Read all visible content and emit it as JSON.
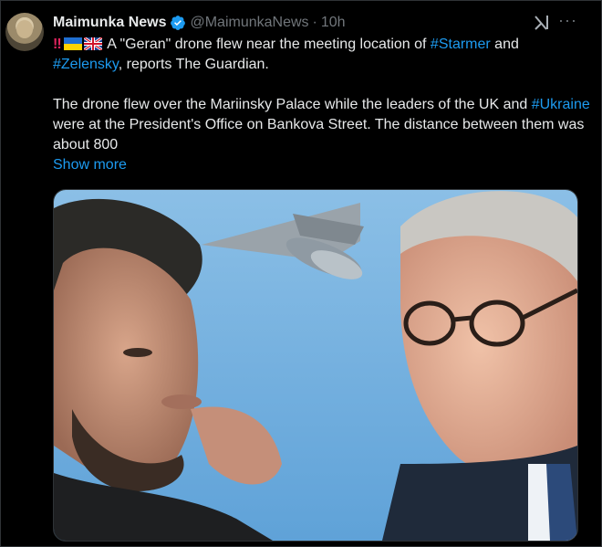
{
  "post": {
    "author_name": "Maimunka News",
    "author_handle": "@MaimunkaNews",
    "separator": "·",
    "time": "10h",
    "alert_emoji": "‼",
    "text_line1": "A \"Geran\" drone flew near the meeting location of ",
    "tag_starmer": "#Starmer",
    "and_word": " and",
    "tag_zelensky": "#Zelensky",
    "reports": ", reports The Guardian.",
    "para2_a": "The drone flew over the Mariinsky Palace while the leaders of the UK and ",
    "tag_ukraine": "#Ukraine",
    "para2_b": " were at the President's Office on Bankova Street. The distance between them was about 800",
    "show_more": "Show more"
  },
  "icons": [
    "verified-badge-icon",
    "grok-icon",
    "more-options-icon",
    "ukraine-flag-icon",
    "uk-flag-icon"
  ],
  "colors": {
    "accent": "#1d9bf0",
    "background": "#000000",
    "text": "#e7e9ea",
    "muted": "#71767b"
  }
}
